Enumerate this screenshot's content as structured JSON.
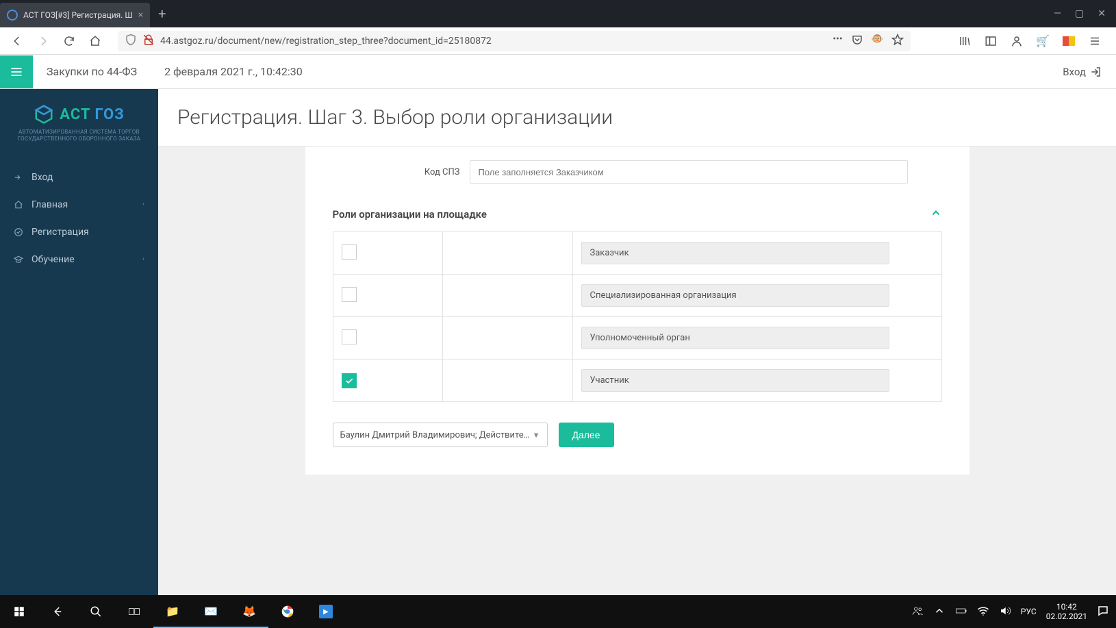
{
  "browser": {
    "tab_title": "АСТ ГОЗ[#3] Регистрация. Ш",
    "url": "44.astgoz.ru/document/new/registration_step_three?document_id=25180872"
  },
  "header": {
    "section": "Закупки по 44-ФЗ",
    "datetime": "2 февраля 2021 г., 10:42:30",
    "login": "Вход"
  },
  "logo": {
    "part1": "АСТ",
    "part2": "ГОЗ",
    "subtitle": "АВТОМАТИЗИРОВАННАЯ СИСТЕМА ТОРГОВ ГОСУДАРСТВЕННОГО ОБОРОННОГО ЗАКАЗА"
  },
  "nav": {
    "items": [
      {
        "label": "Вход",
        "expandable": false
      },
      {
        "label": "Главная",
        "expandable": true
      },
      {
        "label": "Регистрация",
        "expandable": false
      },
      {
        "label": "Обучение",
        "expandable": true
      }
    ]
  },
  "page": {
    "title": "Регистрация. Шаг 3. Выбор роли организации"
  },
  "form": {
    "spz_label": "Код СПЗ",
    "spz_placeholder": "Поле заполняется Заказчиком",
    "roles_header": "Роли организации на площадке",
    "roles": [
      {
        "label": "Заказчик",
        "checked": false
      },
      {
        "label": "Специализированная организация",
        "checked": false
      },
      {
        "label": "Уполномоченный орган",
        "checked": false
      },
      {
        "label": "Участник",
        "checked": true
      }
    ],
    "cert_selected": "Баулин Дмитрий Владимирович; Действителен …",
    "next_button": "Далее"
  },
  "taskbar": {
    "lang": "РУС",
    "time": "10:42",
    "date": "02.02.2021"
  }
}
